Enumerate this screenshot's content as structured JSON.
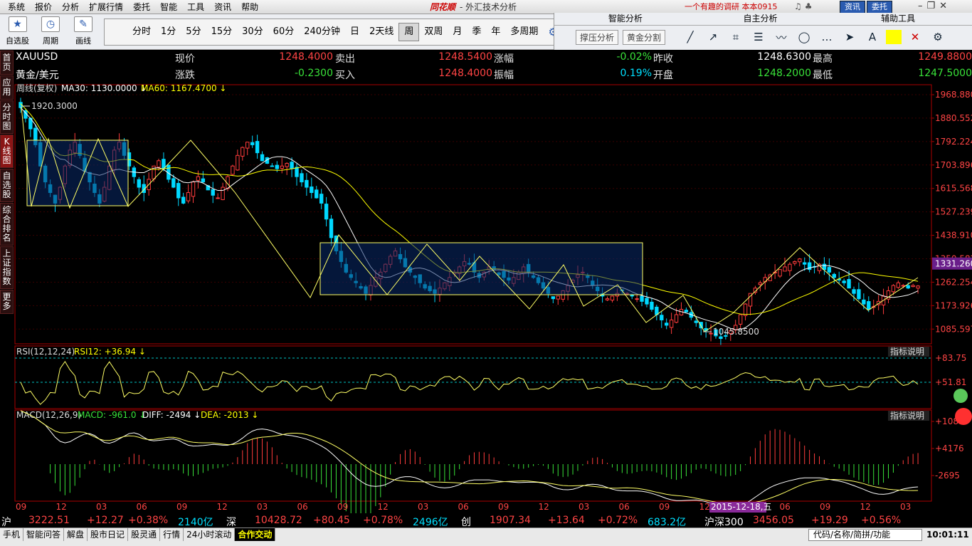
{
  "menubar": {
    "items": [
      "系统",
      "报价",
      "分析",
      "扩展行情",
      "委托",
      "智能",
      "工具",
      "资讯",
      "帮助"
    ],
    "brand": "同花顺",
    "title": "- 外汇技术分析",
    "promo": "一个有趣的调研  本本0915",
    "buttons": [
      "资讯",
      "委托"
    ]
  },
  "toolbar": {
    "left": [
      {
        "label": "自选股",
        "icon": "star-icon"
      },
      {
        "label": "周期",
        "icon": "clock-icon"
      },
      {
        "label": "画线",
        "icon": "pen-icon"
      }
    ],
    "periods": [
      "分时",
      "1分",
      "5分",
      "15分",
      "30分",
      "60分",
      "240分钟",
      "日",
      "2天线",
      "周",
      "双周",
      "月",
      "季",
      "年",
      "多周期"
    ],
    "active_period": "周"
  },
  "analysis": {
    "headers": [
      "智能分析",
      "自主分析",
      "辅助工具"
    ],
    "buttons": [
      "撑压分析",
      "黄金分割"
    ]
  },
  "sidebar": [
    {
      "label": "首页",
      "active": false
    },
    {
      "label": "应用",
      "active": false
    },
    {
      "label": "分时图",
      "active": false
    },
    {
      "label": "K线图",
      "active": true
    },
    {
      "label": "自选股",
      "active": false
    },
    {
      "label": "综合排名",
      "active": false
    },
    {
      "label": "上证指数",
      "active": false
    },
    {
      "label": "更多",
      "active": false
    }
  ],
  "quote": {
    "symbol": "XAUUSD",
    "name": "黄金/美元",
    "row1": [
      {
        "label": "现价",
        "value": "1248.4000",
        "color": "red"
      },
      {
        "label": "卖出",
        "value": "1248.5400",
        "color": "red"
      },
      {
        "label": "涨幅",
        "value": "-0.02%",
        "color": "green"
      },
      {
        "label": "昨收",
        "value": "1248.6300",
        "color": "white"
      },
      {
        "label": "最高",
        "value": "1249.8800",
        "color": "red"
      }
    ],
    "row2": [
      {
        "label": "涨跌",
        "value": "-0.2300",
        "color": "green"
      },
      {
        "label": "买入",
        "value": "1248.4000",
        "color": "red"
      },
      {
        "label": "振幅",
        "value": "0.19%",
        "color": "cyan"
      },
      {
        "label": "开盘",
        "value": "1248.2000",
        "color": "green"
      },
      {
        "label": "最低",
        "value": "1247.5000",
        "color": "green"
      }
    ]
  },
  "chart_data": {
    "type": "candlestick",
    "period_label": "周线(复权)",
    "ma_labels": [
      {
        "text": "MA30: 1130.0000",
        "color": "#ffffff"
      },
      {
        "text": "MA60: 1167.4700",
        "color": "#ffff00"
      }
    ],
    "price_axis": [
      "1968.8800",
      "1880.5521",
      "1792.2242",
      "1703.8963",
      "1615.5684",
      "1527.2395",
      "1438.9106",
      "1350.5827",
      "1262.2548",
      "1173.9269",
      "1085.5970"
    ],
    "price_range": [
      1030,
      1968.88
    ],
    "current_price_tag": "1331.2600",
    "high_mark": "1920.3000",
    "low_mark": "1045.8500",
    "rsi": {
      "label": "RSI(12,12,24)",
      "value_label": "RSI12: +36.94",
      "axis": [
        "+83.75",
        "+51.81"
      ],
      "desc": "指标说明"
    },
    "macd": {
      "label": "MACD(12,26,9)",
      "macd": "MACD: -961.0",
      "diff": "DIFF: -2494",
      "dea": "DEA: -2013",
      "axis": [
        "+1086",
        "+4176",
        "-2695"
      ],
      "desc": "指标说明"
    },
    "time_axis": [
      "09",
      "12",
      "03",
      "06",
      "09",
      "12",
      "03",
      "06",
      "09",
      "12",
      "03",
      "06",
      "09",
      "12",
      "03",
      "06",
      "09",
      "12",
      "03",
      "06",
      "09",
      "12",
      "03"
    ],
    "cursor_date": "2015-12-18,五",
    "closes": [
      1920,
      1880,
      1840,
      1780,
      1700,
      1640,
      1600,
      1560,
      1620,
      1700,
      1760,
      1790,
      1740,
      1680,
      1640,
      1600,
      1560,
      1620,
      1700,
      1760,
      1790,
      1740,
      1700,
      1660,
      1620,
      1600,
      1650,
      1700,
      1720,
      1690,
      1650,
      1620,
      1580,
      1560,
      1600,
      1640,
      1660,
      1640,
      1610,
      1590,
      1580,
      1620,
      1660,
      1700,
      1740,
      1770,
      1790,
      1780,
      1750,
      1720,
      1710,
      1700,
      1690,
      1700,
      1710,
      1690,
      1660,
      1640,
      1620,
      1600,
      1580,
      1560,
      1500,
      1430,
      1380,
      1340,
      1300,
      1280,
      1260,
      1240,
      1220,
      1250,
      1280,
      1300,
      1330,
      1360,
      1380,
      1350,
      1320,
      1300,
      1280,
      1260,
      1240,
      1230,
      1220,
      1240,
      1260,
      1280,
      1300,
      1320,
      1340,
      1330,
      1300,
      1280,
      1300,
      1320,
      1310,
      1290,
      1280,
      1270,
      1280,
      1300,
      1320,
      1300,
      1280,
      1260,
      1240,
      1220,
      1200,
      1210,
      1230,
      1250,
      1270,
      1290,
      1300,
      1280,
      1250,
      1230,
      1210,
      1200,
      1210,
      1220,
      1230,
      1220,
      1210,
      1200,
      1190,
      1180,
      1160,
      1140,
      1120,
      1100,
      1120,
      1140,
      1160,
      1150,
      1130,
      1110,
      1090,
      1080,
      1070,
      1060,
      1050,
      1060,
      1080,
      1100,
      1140,
      1180,
      1220,
      1240,
      1260,
      1280,
      1290,
      1300,
      1310,
      1320,
      1330,
      1340,
      1350,
      1330,
      1310,
      1320,
      1330,
      1310,
      1300,
      1280,
      1270,
      1260,
      1240,
      1220,
      1200,
      1180,
      1160,
      1170,
      1190,
      1210,
      1230,
      1250,
      1260,
      1250,
      1240,
      1250,
      1248
    ]
  },
  "status1": [
    {
      "text": "沪",
      "color": "#fff"
    },
    {
      "text": "3222.51",
      "color": "#ff4444"
    },
    {
      "text": "+12.27",
      "color": "#ff4444"
    },
    {
      "text": "+0.38%",
      "color": "#ff4444"
    },
    {
      "text": "2140亿",
      "color": "#00e0ff"
    },
    {
      "text": "深",
      "color": "#fff"
    },
    {
      "text": "10428.72",
      "color": "#ff4444"
    },
    {
      "text": "+80.45",
      "color": "#ff4444"
    },
    {
      "text": "+0.78%",
      "color": "#ff4444"
    },
    {
      "text": "2496亿",
      "color": "#00e0ff"
    },
    {
      "text": "创",
      "color": "#fff"
    },
    {
      "text": "1907.34",
      "color": "#ff4444"
    },
    {
      "text": "+13.64",
      "color": "#ff4444"
    },
    {
      "text": "+0.72%",
      "color": "#ff4444"
    },
    {
      "text": "683.2亿",
      "color": "#00e0ff"
    },
    {
      "text": "沪深300",
      "color": "#fff"
    },
    {
      "text": "3456.05",
      "color": "#ff4444"
    },
    {
      "text": "+19.29",
      "color": "#ff4444"
    },
    {
      "text": "+0.56%",
      "color": "#ff4444"
    }
  ],
  "status2": {
    "tabs": [
      "手机",
      "智能问答",
      "解盘",
      "股市日记",
      "股灵通",
      "行情",
      "24小时滚动",
      "合作交动"
    ],
    "search_placeholder": "代码/名称/简拼/功能",
    "clock": "10:01:11"
  }
}
